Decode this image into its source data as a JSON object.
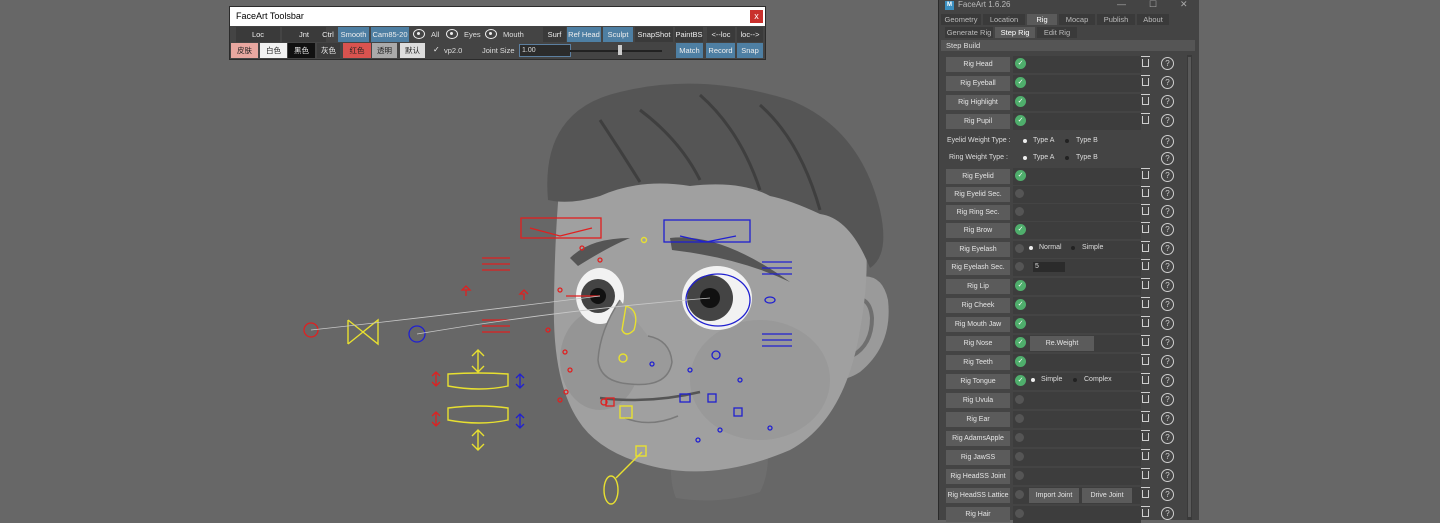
{
  "toolbar": {
    "title": "FaceArt  Toolsbar",
    "close_glyph": "x",
    "row1": {
      "loc": "Loc",
      "jnt": "Jnt",
      "ctrl": "Ctrl",
      "smooth": "Smooth",
      "cam": "Cam85-20",
      "all": "All",
      "eyes": "Eyes",
      "mouth": "Mouth",
      "surf": "Surf",
      "ref_head": "Ref Head",
      "sculpt": "Sculpt",
      "snapshot": "SnapShot",
      "paintbs": "PaintBS",
      "to_loc": "<--loc",
      "from_loc": "loc-->"
    },
    "row2": {
      "skin": "皮肤",
      "white": "白色",
      "black": "黑色",
      "grey": "灰色",
      "red": "红色",
      "transparent": "透明",
      "default": "默认",
      "vp2": "vp2.0",
      "vp2_checked": true,
      "joint_size_label": "Joint Size",
      "joint_size_value": "1.00",
      "joint_size_slider": 0.55,
      "match": "Match",
      "record": "Record",
      "snap": "Snap"
    }
  },
  "panel": {
    "title": "FaceArt  1.6.26",
    "logo": "M",
    "window_controls": [
      "—",
      "☐",
      "✕"
    ],
    "tabs": [
      "Geometry",
      "Location",
      "Rig",
      "Mocap",
      "Publish",
      "About"
    ],
    "active_tab": "Rig",
    "subtabs": [
      "Generate Rig",
      "Step Rig",
      "Edit Rig"
    ],
    "active_subtab": "Step Rig",
    "step_header": "Step Build",
    "help_glyph": "?",
    "check_glyph": "✓",
    "rows": {
      "rig_head": "Rig Head",
      "rig_eyeball": "Rig Eyeball",
      "rig_highlight": "Rig Highlight",
      "rig_pupil": "Rig Pupil",
      "eyelid_weight_label": "Eyelid Weight Type :",
      "ring_weight_label": "Ring Weight Type :",
      "type_a": "Type A",
      "type_b": "Type B",
      "rig_eyelid": "Rig Eyelid",
      "rig_eyelid_sec": "Rig Eyelid Sec.",
      "rig_ring_sec": "Rig Ring Sec.",
      "rig_brow": "Rig Brow",
      "rig_eyelash": "Rig Eyelash",
      "normal": "Normal",
      "simple": "Simple",
      "rig_eyelash_sec": "Rig Eyelash Sec.",
      "eyelash_sec_value": "5",
      "rig_lip": "Rig Lip",
      "rig_cheek": "Rig Cheek",
      "rig_mouth_jaw": "Rig Mouth Jaw",
      "rig_nose": "Rig Nose",
      "re_weight": "Re.Weight",
      "rig_teeth": "Rig Teeth",
      "rig_tongue": "Rig Tongue",
      "complex": "Complex",
      "rig_uvula": "Rig Uvula",
      "rig_ear": "Rig Ear",
      "rig_adamsapple": "Rig AdamsApple",
      "rig_jawss": "Rig JawSS",
      "rig_headss_joint": "Rig HeadSS Joint",
      "rig_headss_lattice": "Rig HeadSS Lattice",
      "import_joint": "Import Joint",
      "drive_joint": "Drive Joint",
      "rig_hair": "Rig Hair"
    }
  },
  "colors": {
    "viewport_bg": "#676767",
    "accent_blue": "#4e7fa3",
    "status_green": "#4fae6c",
    "ctrl_red": "#e02020",
    "ctrl_blue": "#2020d0",
    "ctrl_yellow": "#e8e030"
  }
}
